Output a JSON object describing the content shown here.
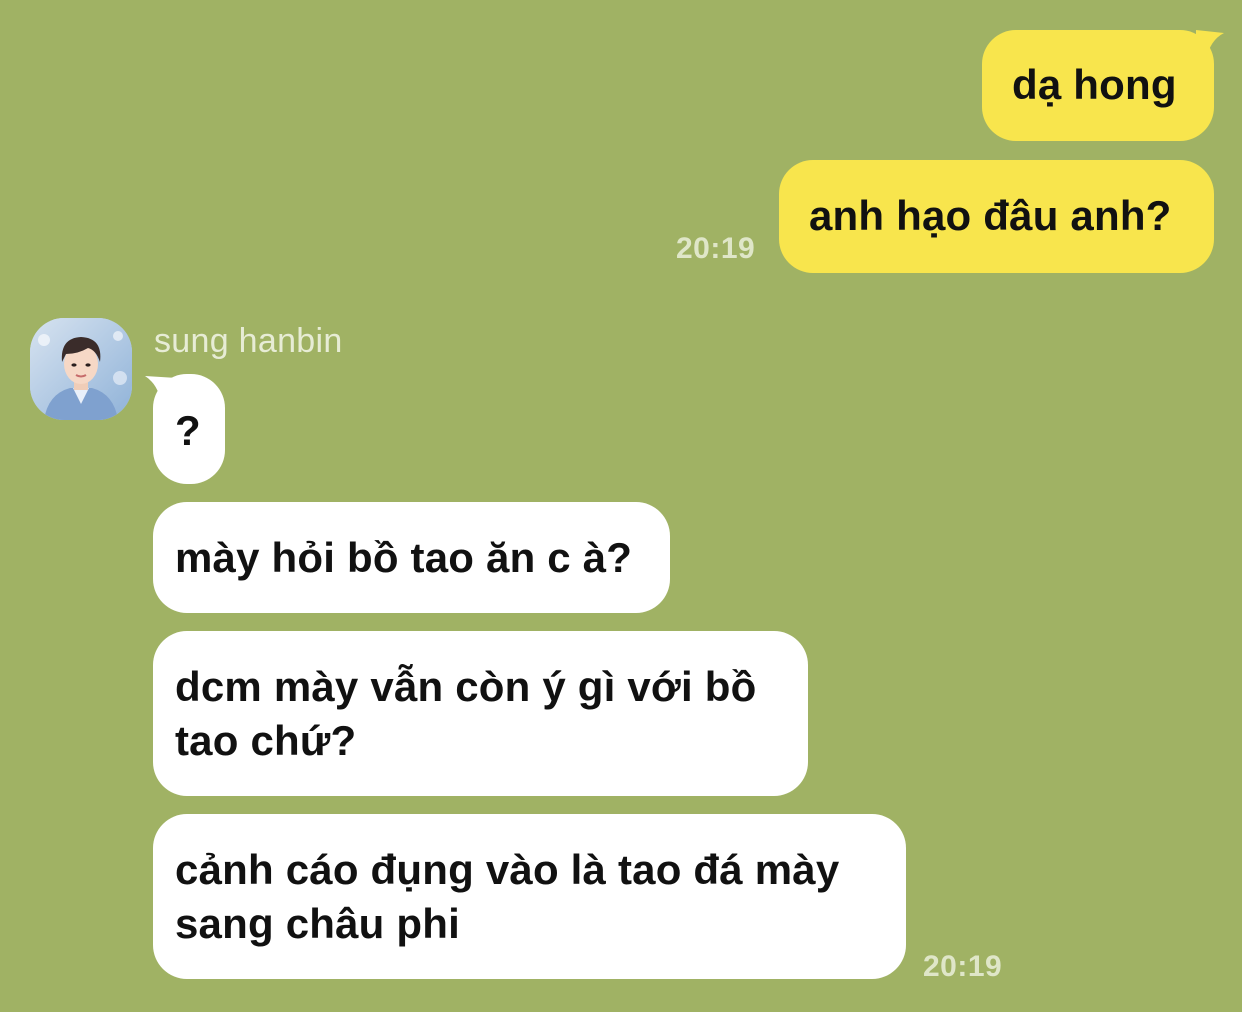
{
  "colors": {
    "background": "#a0b264",
    "outgoing_bubble": "#f8e54d",
    "incoming_bubble": "#ffffff",
    "timestamp": "#dfe6c8"
  },
  "outgoing": {
    "messages": [
      {
        "text": "dạ hong"
      },
      {
        "text": "anh hạo đâu anh?"
      }
    ],
    "time": "20:19"
  },
  "incoming": {
    "sender": "sung hanbin",
    "avatar_icon": "profile-photo-avatar",
    "messages": [
      {
        "text": "?"
      },
      {
        "text": "mày hỏi bồ tao ăn c à?"
      },
      {
        "text": "dcm mày vẫn còn ý gì với bồ tao chứ?"
      },
      {
        "text": "cảnh cáo đụng vào là tao đá mày sang châu phi"
      }
    ],
    "time": "20:19"
  }
}
